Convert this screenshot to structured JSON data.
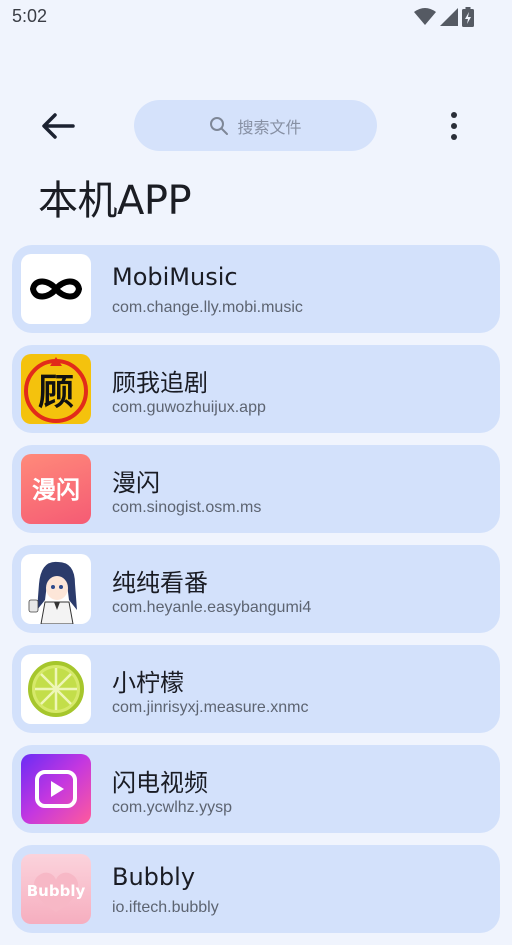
{
  "status_bar": {
    "time": "5:02"
  },
  "header": {
    "search_placeholder": "搜索文件",
    "title": "本机APP"
  },
  "apps": [
    {
      "name": "MobiMusic",
      "package": "com.change.lly.mobi.music",
      "icon": "infinity-icon"
    },
    {
      "name": "顾我追剧",
      "package": "com.guwozhuijux.app",
      "icon": "guwo-icon",
      "icon_text": "顾"
    },
    {
      "name": "漫闪",
      "package": "com.sinogist.osm.ms",
      "icon": "manshan-icon",
      "icon_text": "漫闪"
    },
    {
      "name": "纯纯看番",
      "package": "com.heyanle.easybangumi4",
      "icon": "anime-girl-icon"
    },
    {
      "name": "小柠檬",
      "package": "com.jinrisyxj.measure.xnmc",
      "icon": "lemon-icon"
    },
    {
      "name": "闪电视频",
      "package": "com.ycwlhz.yysp",
      "icon": "play-icon"
    },
    {
      "name": "Bubbly",
      "package": "io.iftech.bubbly",
      "icon": "bubbly-icon",
      "icon_text": "Bubbly"
    }
  ],
  "colors": {
    "background": "#f0f4fd",
    "card": "#d3e1fb",
    "search": "#d5e2fb"
  }
}
